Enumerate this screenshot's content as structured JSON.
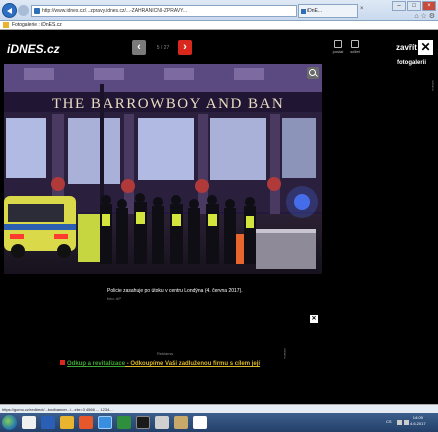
{
  "browser": {
    "address": "http://www.idnes.cz/...zpravy.idnes.cz/...-ZAHRANICNI-ZPRAVY...",
    "tab_title": "iDnE...",
    "tab_favorites": "Fotogalerie : iDnES.cz",
    "win_min": "–",
    "win_max": "□",
    "win_close": "×",
    "ie_icons": "⌂ ☆ ⚙"
  },
  "gallery": {
    "logo": "iDNES.cz",
    "prev_arrow": "‹",
    "next_arrow": "›",
    "counter": "5 / 27",
    "tools": [
      "poslat",
      "sdílet"
    ],
    "close_label": "zavřít",
    "close_symbol": "✕",
    "section_label": "fotogalerii",
    "side_ad": "reklama",
    "photo": {
      "sign_text": "THE BARROWBOY AND BAN"
    },
    "caption": "Policie zasahuje po útoku v centru Londýna (4. června 2017).",
    "credit": "foto: AP",
    "caption_close": "✕"
  },
  "ad": {
    "label": "Reklama",
    "side_label": "reklama",
    "part1": "Odkup a revitalizace",
    "separator": " - ",
    "part2": "Odkoupíme Vaši zadluženou firmu s cílem její"
  },
  "status_bar": {
    "url": "https://gcmo.cz/redirect/...bodbanner.../...ebr=3 4566 ... 1234..."
  },
  "taskbar": {
    "lang": "CS",
    "time": "14:09",
    "date": "4.6.2017"
  },
  "colors": {
    "accent_red": "#d8271d",
    "ad_green": "#3fa834",
    "ad_yellow": "#ddb92a"
  }
}
